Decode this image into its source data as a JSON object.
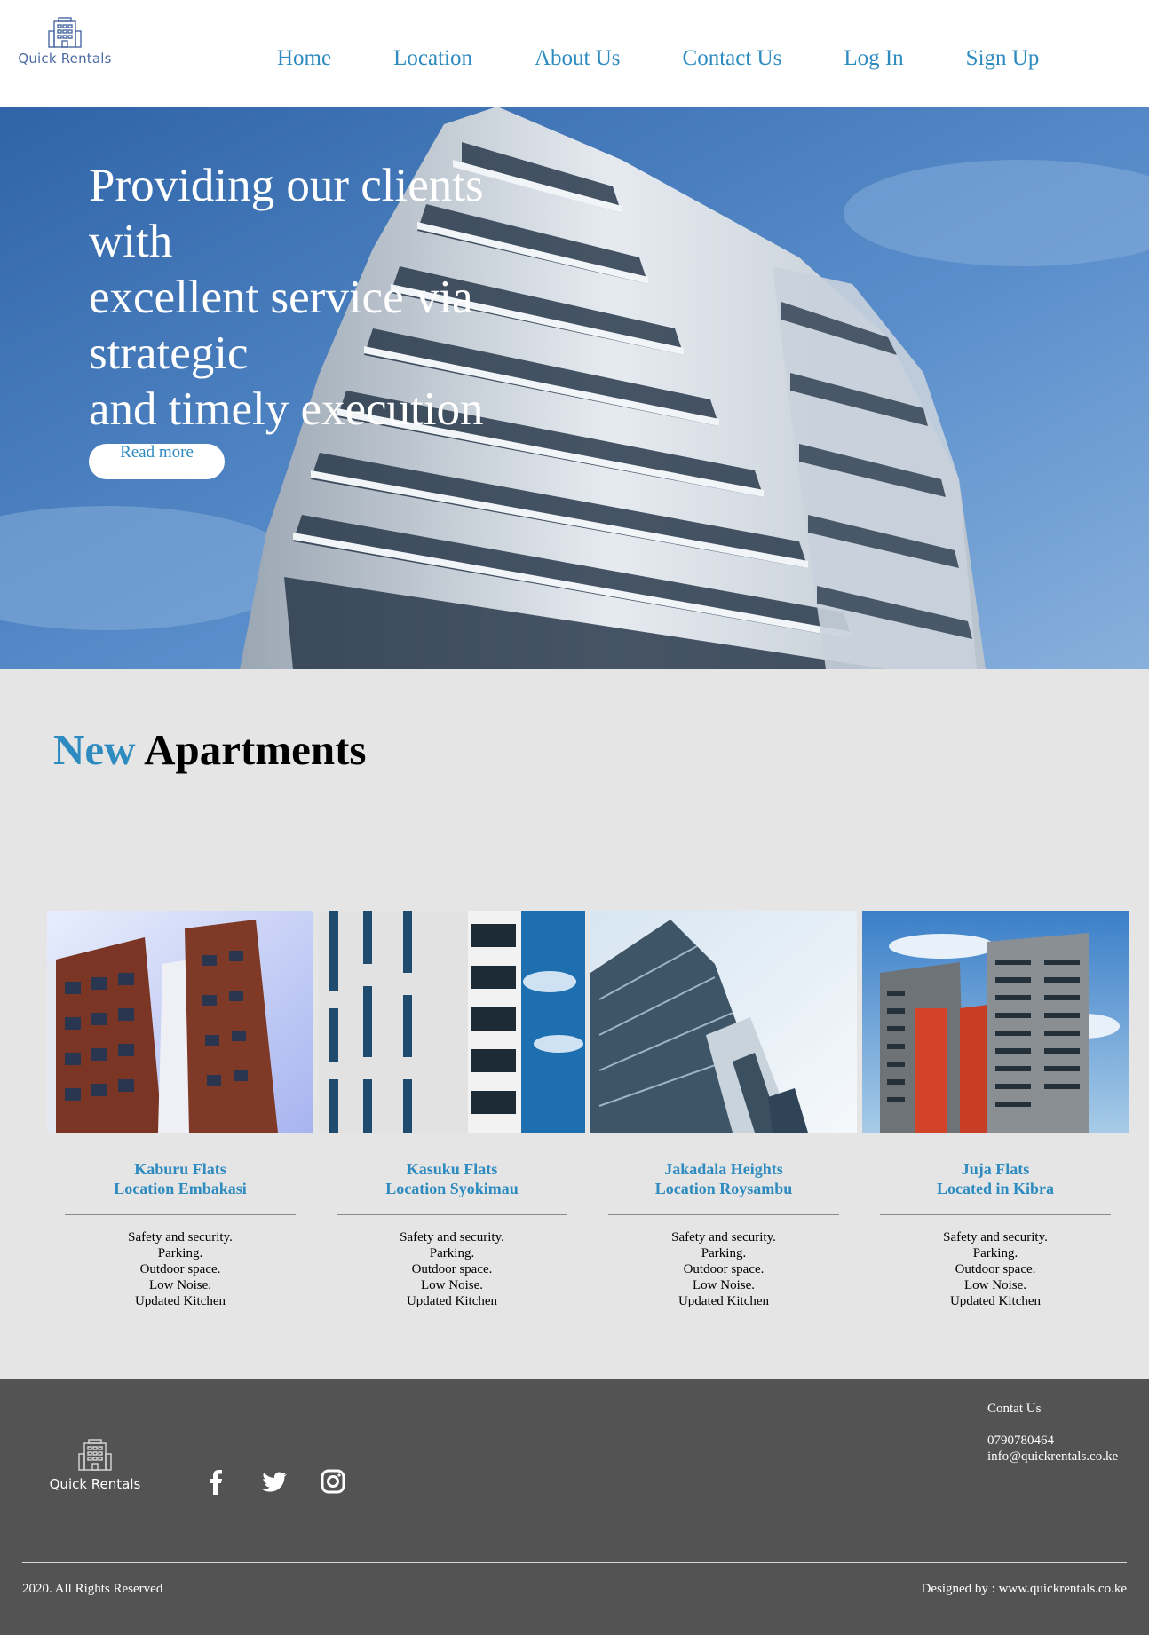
{
  "brand": {
    "name": "Quick Rentals"
  },
  "nav": {
    "items": [
      {
        "label": "Home"
      },
      {
        "label": "Location"
      },
      {
        "label": "About Us"
      },
      {
        "label": "Contact Us"
      },
      {
        "label": "Log In"
      },
      {
        "label": "Sign Up"
      }
    ]
  },
  "hero": {
    "title_lines": [
      "Providing our clients",
      "with",
      "excellent service via",
      "strategic",
      "and timely execution"
    ],
    "button_label": "Read more"
  },
  "section": {
    "title_accent": "New",
    "title_rest": "Apartments"
  },
  "apartments": [
    {
      "name": "Kaburu Flats",
      "location": "Location Embakasi",
      "features": [
        "Safety and security.",
        "Parking.",
        "Outdoor space.",
        "Low Noise.",
        "Updated Kitchen"
      ]
    },
    {
      "name": "Kasuku Flats",
      "location": "Location Syokimau",
      "features": [
        "Safety and security.",
        "Parking.",
        "Outdoor space.",
        "Low Noise.",
        "Updated Kitchen"
      ]
    },
    {
      "name": "Jakadala Heights",
      "location": "Location Roysambu",
      "features": [
        "Safety and security.",
        "Parking.",
        "Outdoor space.",
        "Low Noise.",
        "Updated Kitchen"
      ]
    },
    {
      "name": "Juja Flats",
      "location": "Located in Kibra",
      "features": [
        "Safety and security.",
        "Parking.",
        "Outdoor space.",
        "Low Noise.",
        "Updated Kitchen"
      ]
    }
  ],
  "footer": {
    "contact_title": "Contat Us",
    "phone": "0790780464",
    "email": "info@quickrentals.co.ke",
    "social_icons": [
      "facebook-icon",
      "twitter-icon",
      "instagram-icon"
    ],
    "copyright": "2020. All Rights Reserved",
    "designed_by": "Designed by : www.quickrentals.co.ke"
  },
  "colors": {
    "accent": "#2e8bc0",
    "footer_bg": "#535353",
    "section_bg": "#e5e5e5"
  }
}
